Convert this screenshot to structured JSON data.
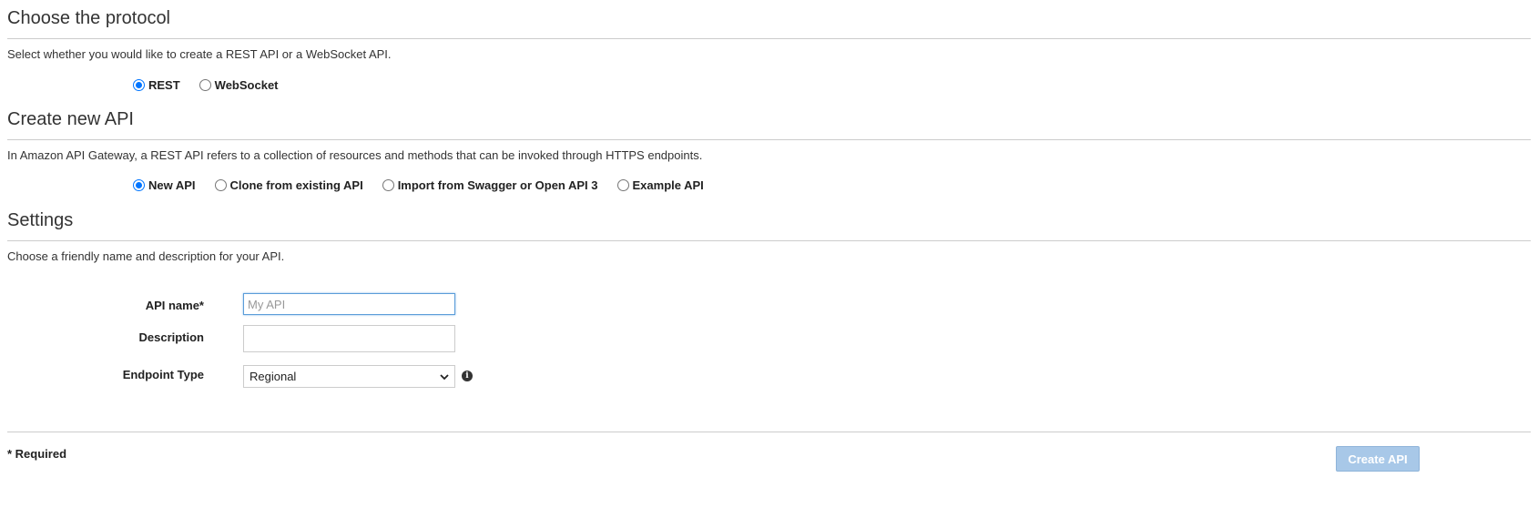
{
  "protocol": {
    "title": "Choose the protocol",
    "description": "Select whether you would like to create a REST API or a WebSocket API.",
    "options": [
      {
        "label": "REST",
        "checked": true
      },
      {
        "label": "WebSocket",
        "checked": false
      }
    ]
  },
  "create_api": {
    "title": "Create new API",
    "description": "In Amazon API Gateway, a REST API refers to a collection of resources and methods that can be invoked through HTTPS endpoints.",
    "options": [
      {
        "label": "New API",
        "checked": true
      },
      {
        "label": "Clone from existing API",
        "checked": false
      },
      {
        "label": "Import from Swagger or Open API 3",
        "checked": false
      },
      {
        "label": "Example API",
        "checked": false
      }
    ]
  },
  "settings": {
    "title": "Settings",
    "description": "Choose a friendly name and description for your API.",
    "api_name_label": "API name*",
    "api_name_placeholder": "My API",
    "api_name_value": "",
    "description_label": "Description",
    "description_value": "",
    "endpoint_type_label": "Endpoint Type",
    "endpoint_type_value": "Regional",
    "info_icon": "info-icon"
  },
  "footer": {
    "required_note": "* Required",
    "create_button": "Create API"
  },
  "colors": {
    "radio_checked": "#0075ff",
    "create_button_disabled": "#a8c8e8",
    "rule": "#cccccc"
  }
}
